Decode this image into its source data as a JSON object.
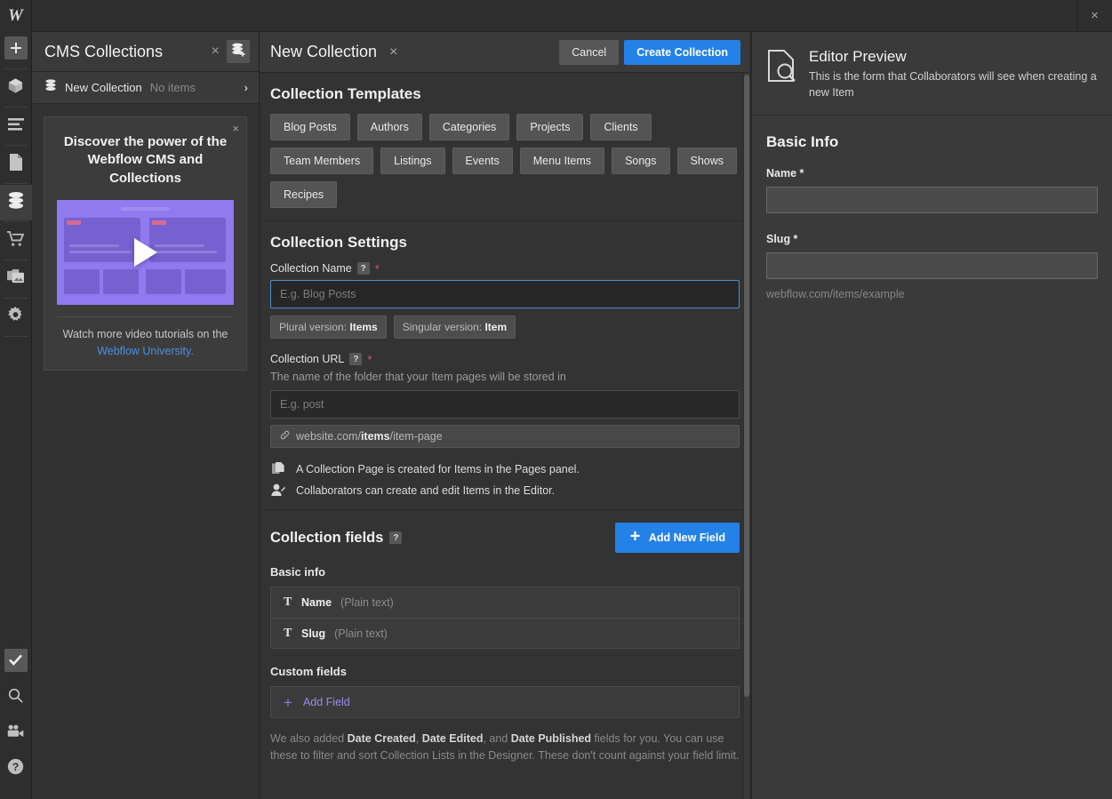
{
  "window": {
    "close_label": "×"
  },
  "rail": {
    "logo": "W",
    "items": [
      {
        "name": "add-elements",
        "icon": "plus-icon"
      },
      {
        "name": "components",
        "icon": "cube-icon"
      },
      {
        "name": "navigator",
        "icon": "layers-list-icon"
      },
      {
        "name": "pages",
        "icon": "page-icon"
      },
      {
        "name": "cms",
        "icon": "database-icon"
      },
      {
        "name": "ecommerce",
        "icon": "shopping-cart-icon"
      },
      {
        "name": "assets",
        "icon": "images-icon"
      },
      {
        "name": "settings",
        "icon": "gear-icon"
      }
    ],
    "bottom_items": [
      {
        "name": "audit",
        "icon": "checkmark-icon"
      },
      {
        "name": "search",
        "icon": "search-icon"
      },
      {
        "name": "video",
        "icon": "video-camera-icon"
      },
      {
        "name": "help",
        "icon": "question-mark-icon"
      }
    ]
  },
  "collections_panel": {
    "title": "CMS Collections",
    "close_label": "×",
    "add_collection_icon": "database-plus-icon",
    "rows": [
      {
        "icon": "database-icon",
        "name": "New Collection",
        "sub": "No items",
        "chevron": "›"
      }
    ],
    "promo": {
      "close_label": "×",
      "title": "Discover the power of the Webflow CMS and Collections",
      "video_icon": "play-icon",
      "footer_text": "Watch more video tutorials on the",
      "footer_link": "Webflow University."
    }
  },
  "new_collection": {
    "title": "New Collection",
    "close_label": "×",
    "cancel_label": "Cancel",
    "create_label": "Create Collection",
    "templates": {
      "title": "Collection Templates",
      "items": [
        "Blog Posts",
        "Authors",
        "Categories",
        "Projects",
        "Clients",
        "Team Members",
        "Listings",
        "Events",
        "Menu Items",
        "Songs",
        "Shows",
        "Recipes"
      ]
    },
    "settings": {
      "title": "Collection Settings",
      "name_label": "Collection Name",
      "name_help": "?",
      "name_required": "*",
      "name_value": "",
      "name_placeholder": "E.g. Blog Posts",
      "plural_prefix": "Plural version:",
      "plural_value": "Items",
      "singular_prefix": "Singular version:",
      "singular_value": "Item",
      "url_label": "Collection URL",
      "url_help": "?",
      "url_required": "*",
      "url_description": "The name of the folder that your Item pages will be stored in",
      "url_value": "",
      "url_placeholder": "E.g. post",
      "url_preview_icon": "link-icon",
      "url_preview_prefix": "website.com/",
      "url_preview_bold": "items",
      "url_preview_suffix": "/item-page",
      "notes": [
        {
          "icon": "pages-copy-icon",
          "text": "A Collection Page is created for Items in the Pages panel."
        },
        {
          "icon": "user-edit-icon",
          "text": "Collaborators can create and edit Items in the Editor."
        }
      ]
    },
    "fields": {
      "title": "Collection fields",
      "help": "?",
      "add_new_label": "Add New Field",
      "add_new_icon": "plus-icon",
      "basic_group_label": "Basic info",
      "basic_fields": [
        {
          "icon": "text-type-icon",
          "name": "Name",
          "type": "(Plain text)"
        },
        {
          "icon": "text-type-icon",
          "name": "Slug",
          "type": "(Plain text)"
        }
      ],
      "custom_group_label": "Custom fields",
      "add_field_label": "Add Field",
      "add_field_icon": "plus-icon",
      "footnote_prefix": "We also added ",
      "footnote_b1": "Date Created",
      "footnote_mid1": ", ",
      "footnote_b2": "Date Edited",
      "footnote_mid2": ", and ",
      "footnote_b3": "Date Published",
      "footnote_suffix": " fields for you. You can use these to filter and sort Collection Lists in the Designer. These don't count against your field limit."
    }
  },
  "editor_preview": {
    "icon": "document-search-icon",
    "title": "Editor Preview",
    "subtitle": "This is the form that Collaborators will see when creating a new Item",
    "section_title": "Basic Info",
    "name_label": "Name *",
    "name_value": "",
    "slug_label": "Slug *",
    "slug_value": "",
    "slug_hint": "webflow.com/items/example"
  },
  "colors": {
    "accent_blue": "#2481e8",
    "purple": "#9179f0",
    "link_blue": "#4a90e2",
    "required_red": "#e0536c",
    "panel_bg": "#333333",
    "sidebar_bg": "#323232",
    "rail_bg": "#2e2e2e",
    "preview_bg": "#3a3a3a"
  }
}
